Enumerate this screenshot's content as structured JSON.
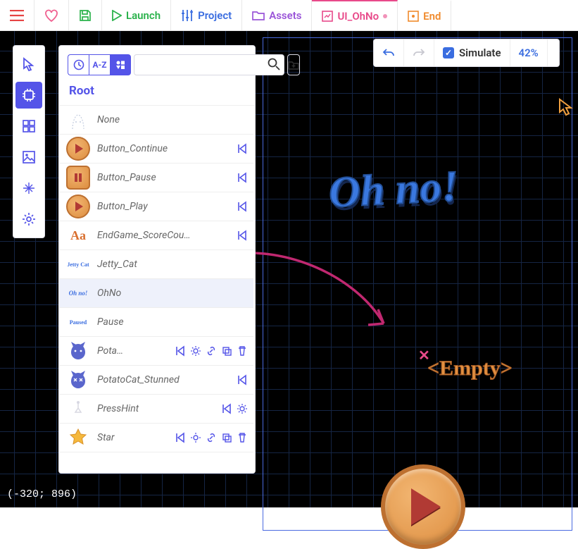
{
  "topbar": {
    "launch": "Launch",
    "project": "Project",
    "assets": "Assets",
    "tab_active": "UI_OhNo",
    "tab_next": "End"
  },
  "simbar": {
    "simulate": "Simulate",
    "zoom": "42%"
  },
  "panel": {
    "sort_label": "A-Z",
    "root": "Root",
    "search_placeholder": ""
  },
  "rows": [
    {
      "label": "None",
      "type": "none"
    },
    {
      "label": "Button_Continue",
      "type": "play"
    },
    {
      "label": "Button_Pause",
      "type": "pause"
    },
    {
      "label": "Button_Play",
      "type": "play"
    },
    {
      "label": "EndGame_ScoreCou…",
      "type": "text"
    },
    {
      "label": "Jetty_Cat",
      "type": "sprite-jetty"
    },
    {
      "label": "OhNo",
      "type": "sprite-ohno",
      "selected": true
    },
    {
      "label": "Pause",
      "type": "sprite-pause"
    },
    {
      "label": "Pota…",
      "type": "cat",
      "full": true
    },
    {
      "label": "PotatoCat_Stunned",
      "type": "cat",
      "mini": true
    },
    {
      "label": "PressHint",
      "type": "hint",
      "mini2": true
    },
    {
      "label": "Star",
      "type": "star",
      "full": true
    }
  ],
  "stage": {
    "title": "Oh no!",
    "empty": "<Empty>"
  },
  "status": {
    "coords": "(-320; 896)"
  },
  "colors": {
    "accent": "#5454e8",
    "brand_pink": "#e84a8a"
  }
}
